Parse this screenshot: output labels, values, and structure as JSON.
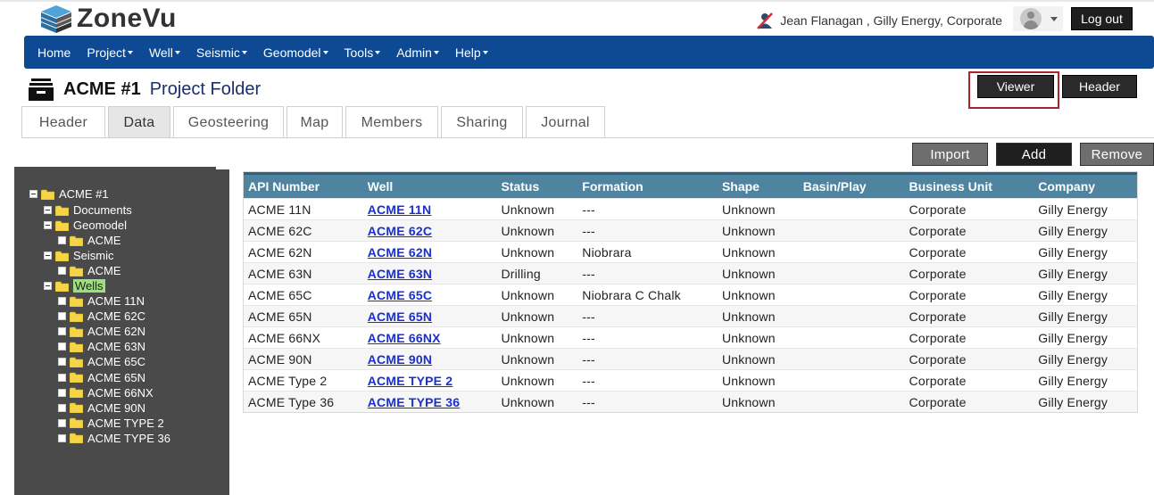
{
  "app": {
    "name": "ZoneVu"
  },
  "user": {
    "display": "Jean Flanagan , Gilly Energy, Corporate",
    "logout_label": "Log out"
  },
  "nav": [
    {
      "label": "Home",
      "dropdown": false
    },
    {
      "label": "Project",
      "dropdown": true
    },
    {
      "label": "Well",
      "dropdown": true
    },
    {
      "label": "Seismic",
      "dropdown": true
    },
    {
      "label": "Geomodel",
      "dropdown": true
    },
    {
      "label": "Tools",
      "dropdown": true
    },
    {
      "label": "Admin",
      "dropdown": true
    },
    {
      "label": "Help",
      "dropdown": true
    }
  ],
  "project": {
    "name": "ACME #1",
    "subtitle": "Project Folder"
  },
  "buttons": {
    "viewer": "Viewer",
    "header": "Header",
    "import": "Import",
    "add": "Add",
    "remove": "Remove"
  },
  "tabs": [
    {
      "label": "Header",
      "active": false
    },
    {
      "label": "Data",
      "active": true
    },
    {
      "label": "Geosteering",
      "active": false
    },
    {
      "label": "Map",
      "active": false
    },
    {
      "label": "Members",
      "active": false
    },
    {
      "label": "Sharing",
      "active": false
    },
    {
      "label": "Journal",
      "active": false
    }
  ],
  "tree": {
    "root": "ACME #1",
    "documents": "Documents",
    "geomodel": "Geomodel",
    "geomodel_child": "ACME",
    "seismic": "Seismic",
    "seismic_child": "ACME",
    "wells": "Wells",
    "wells_children": [
      "ACME 11N",
      "ACME 62C",
      "ACME 62N",
      "ACME 63N",
      "ACME 65C",
      "ACME 65N",
      "ACME 66NX",
      "ACME 90N",
      "ACME TYPE 2",
      "ACME TYPE 36"
    ]
  },
  "table": {
    "columns": [
      "API Number",
      "Well",
      "Status",
      "Formation",
      "Shape",
      "Basin/Play",
      "Business Unit",
      "Company"
    ],
    "rows": [
      [
        "ACME 11N",
        "ACME 11N",
        "Unknown",
        "---",
        "Unknown",
        "",
        "Corporate",
        "Gilly Energy"
      ],
      [
        "ACME 62C",
        "ACME 62C",
        "Unknown",
        "---",
        "Unknown",
        "",
        "Corporate",
        "Gilly Energy"
      ],
      [
        "ACME 62N",
        "ACME 62N",
        "Unknown",
        "Niobrara",
        "Unknown",
        "",
        "Corporate",
        "Gilly Energy"
      ],
      [
        "ACME 63N",
        "ACME 63N",
        "Drilling",
        "---",
        "Unknown",
        "",
        "Corporate",
        "Gilly Energy"
      ],
      [
        "ACME 65C",
        "ACME 65C",
        "Unknown",
        "Niobrara C Chalk",
        "Unknown",
        "",
        "Corporate",
        "Gilly Energy"
      ],
      [
        "ACME 65N",
        "ACME 65N",
        "Unknown",
        "---",
        "Unknown",
        "",
        "Corporate",
        "Gilly Energy"
      ],
      [
        "ACME 66NX",
        "ACME 66NX",
        "Unknown",
        "---",
        "Unknown",
        "",
        "Corporate",
        "Gilly Energy"
      ],
      [
        "ACME 90N",
        "ACME 90N",
        "Unknown",
        "---",
        "Unknown",
        "",
        "Corporate",
        "Gilly Energy"
      ],
      [
        "ACME Type 2",
        "ACME TYPE 2",
        "Unknown",
        "---",
        "Unknown",
        "",
        "Corporate",
        "Gilly Energy"
      ],
      [
        "ACME Type 36",
        "ACME TYPE 36",
        "Unknown",
        "---",
        "Unknown",
        "",
        "Corporate",
        "Gilly Energy"
      ]
    ]
  },
  "colors": {
    "navbar": "#0e4a93",
    "grid_header": "#4f84a0",
    "tree_bg": "#4a4a4a",
    "tree_selected": "#9be07a",
    "highlight_outline": "#a8252b",
    "link": "#1a2fd0"
  }
}
